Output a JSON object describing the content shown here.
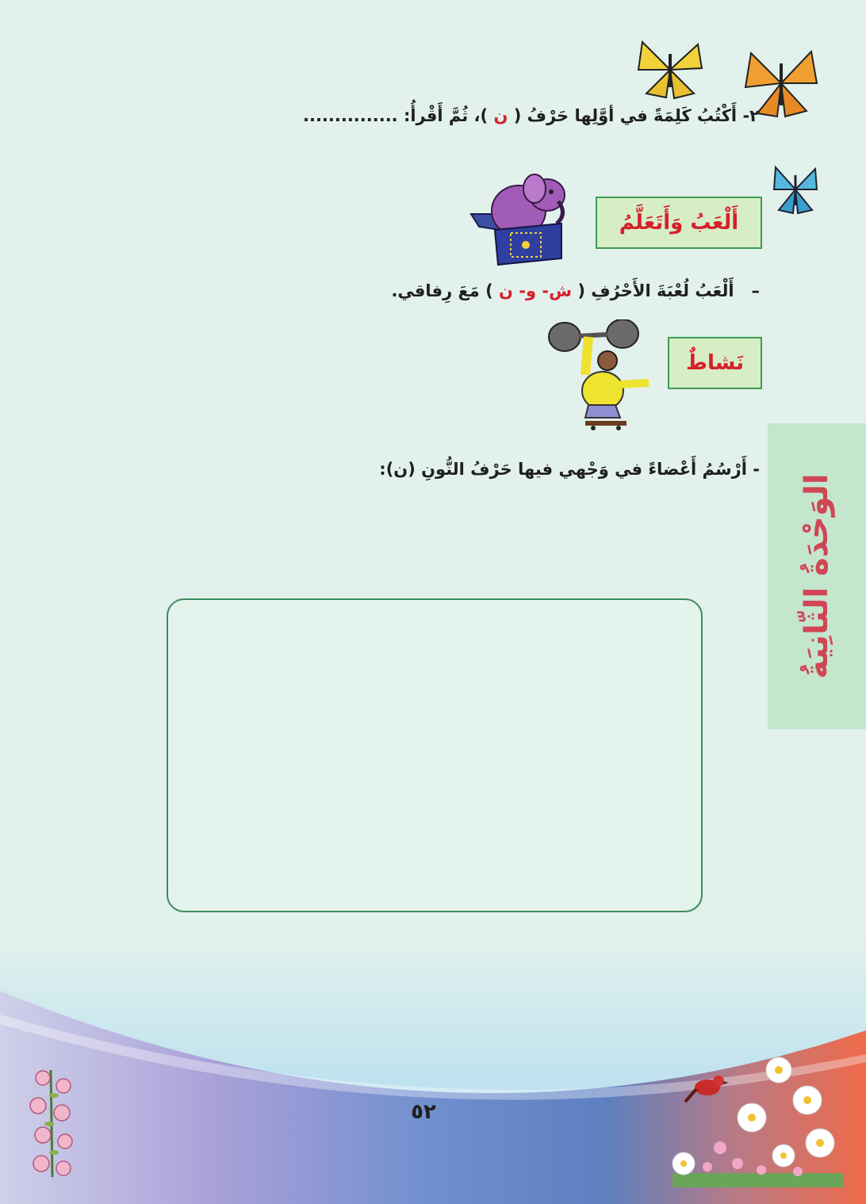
{
  "exercise": {
    "number": "٢-",
    "text_before": "أَكْتُبُ  كَلِمَةً في أوَّلِها حَرْفُ (",
    "letter": "ن",
    "text_after": ")، ثُمَّ أَقْرأُ: ..............."
  },
  "play_learn": {
    "heading": "أَلْعَبُ وَأَتَعَلَّمُ",
    "dash": "–",
    "text_before": "أَلْعَبُ لُعْبَةَ الأَحْرُفِ (",
    "letters": "ش- و- ن",
    "text_after": ") مَعَ رِفاقي."
  },
  "activity": {
    "heading": "نَشاطٌ",
    "instruction": "- أَرْسُمُ أَعْضاءً في وَجْهي فيها حَرْفُ النُّونِ (ن):"
  },
  "side_tab": {
    "label": "الوَحْدَةُ الثّانِيَةُ"
  },
  "page_number": "٥٢",
  "colors": {
    "background": "#e2f1ec",
    "accent_red": "#d6202a",
    "box_green_fill": "#d7edc5",
    "box_green_border": "#3d9b54",
    "side_tab": "#c3e6cd",
    "side_tab_text": "#d04655"
  },
  "icons": [
    "butterfly-yellow-icon",
    "butterfly-orange-icon",
    "butterfly-blue-icon",
    "elephant-in-box-icon",
    "weightlifter-icon",
    "red-bird-icon",
    "flower-bouquet-icon",
    "pink-flowers-icon"
  ]
}
